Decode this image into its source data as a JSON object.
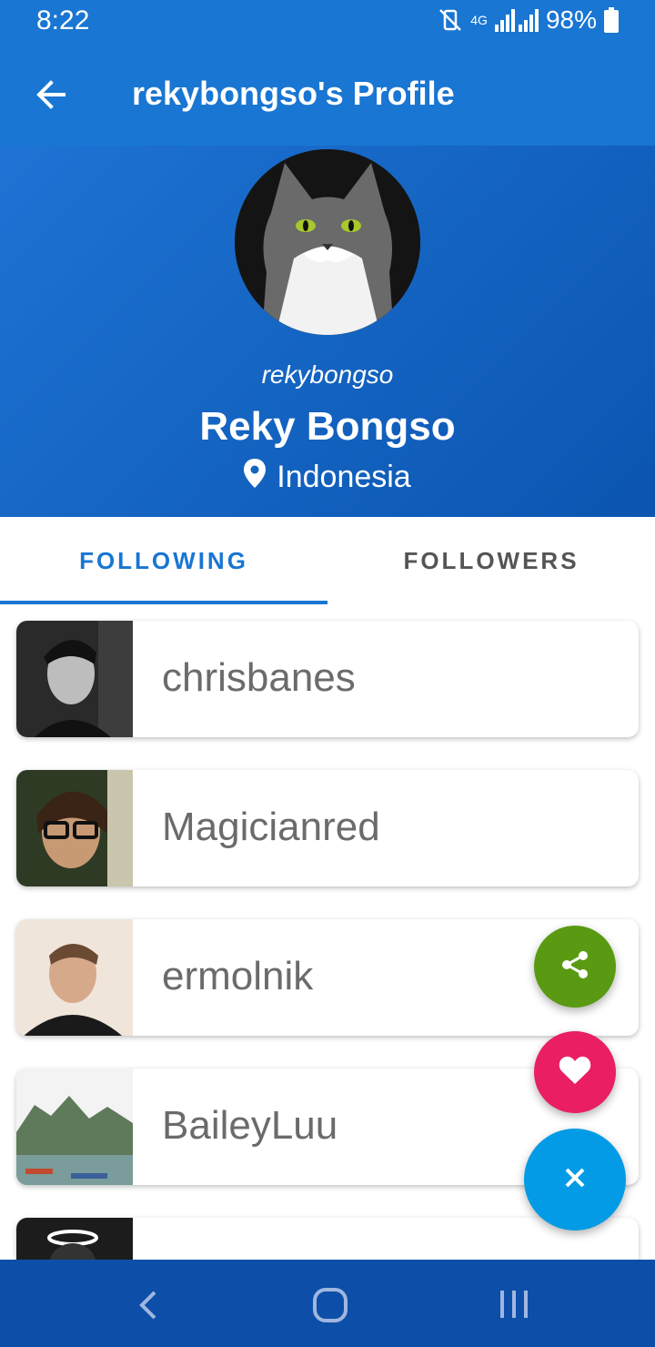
{
  "status_bar": {
    "time": "8:22",
    "network": "4G",
    "battery": "98%"
  },
  "app_bar": {
    "title": "rekybongso's Profile",
    "back_icon": "arrow-back-icon"
  },
  "profile": {
    "username": "rekybongso",
    "full_name": "Reky Bongso",
    "location": "Indonesia",
    "location_icon": "map-pin-icon"
  },
  "tabs": {
    "following": "FOLLOWING",
    "followers": "FOLLOWERS"
  },
  "following_list": [
    {
      "name": "chrisbanes"
    },
    {
      "name": "Magicianred"
    },
    {
      "name": "ermolnik"
    },
    {
      "name": "BaileyLuu"
    },
    {
      "name": ""
    }
  ],
  "fab": {
    "share_icon": "share-icon",
    "favorite_icon": "heart-icon",
    "close_icon": "close-icon"
  },
  "colors": {
    "primary": "#1976D2",
    "share": "#5A9A12",
    "favorite": "#E91E63",
    "close": "#039BE5"
  }
}
